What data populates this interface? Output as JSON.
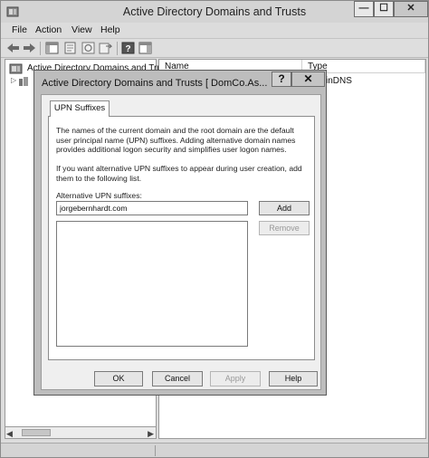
{
  "window": {
    "title": "Active Directory Domains and Trusts",
    "minimize": "—",
    "maximize": "☐",
    "close": "✕"
  },
  "menu": [
    "File",
    "Action",
    "View",
    "Help"
  ],
  "toolbar": {
    "icons": [
      "back-arrow-icon",
      "forward-arrow-icon",
      "console-tree-icon",
      "properties-icon",
      "refresh-icon",
      "export-list-icon",
      "help-icon",
      "show-pane-icon"
    ]
  },
  "tree": {
    "root_label": "Active Directory Domains and Trust"
  },
  "list": {
    "columns": [
      "Name",
      "Type"
    ],
    "row_type_partial": "inDNS"
  },
  "dialog": {
    "title": "Active Directory Domains and Trusts [ DomCo.As...",
    "help_glyph": "?",
    "close_glyph": "✕",
    "tab_label": "UPN Suffixes",
    "paragraph1": "The names of the current domain and the root domain are the default user principal name (UPN) suffixes. Adding alternative domain names provides additional logon security and simplifies user logon names.",
    "paragraph2": "If you want alternative UPN suffixes to appear during user creation, add them to the following list.",
    "alt_label": "Alternative UPN suffixes:",
    "alt_value": "jorgebernhardt.com",
    "add_label": "Add",
    "remove_label": "Remove",
    "suffix_items": [],
    "buttons": {
      "ok": "OK",
      "cancel": "Cancel",
      "apply": "Apply",
      "help": "Help"
    }
  }
}
